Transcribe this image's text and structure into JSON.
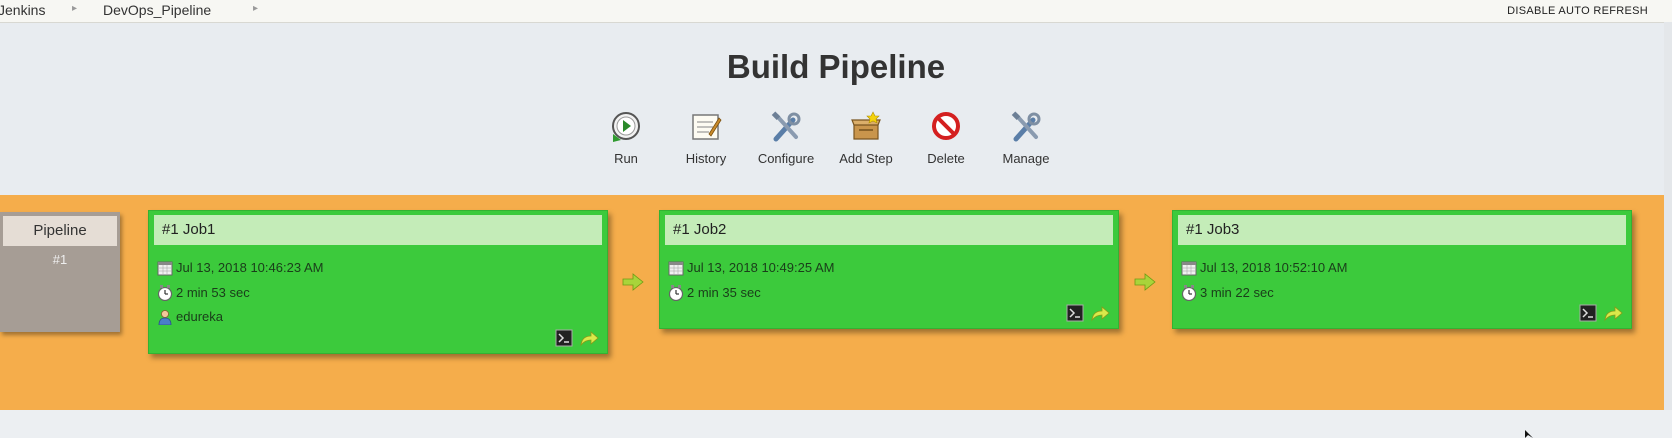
{
  "breadcrumb": {
    "items": [
      "Jenkins",
      "DevOps_Pipeline"
    ]
  },
  "header": {
    "auto_refresh": "DISABLE AUTO REFRESH"
  },
  "title": "Build Pipeline",
  "toolbar": {
    "run": "Run",
    "history": "History",
    "configure": "Configure",
    "add_step": "Add Step",
    "delete": "Delete",
    "manage": "Manage"
  },
  "pipeline": {
    "label": "Pipeline",
    "number": "#1"
  },
  "jobs": [
    {
      "title": "#1 Job1",
      "date": "Jul 13, 2018 10:46:23 AM",
      "duration": "2 min 53 sec",
      "user": "edureka"
    },
    {
      "title": "#1 Job2",
      "date": "Jul 13, 2018 10:49:25 AM",
      "duration": "2 min 35 sec"
    },
    {
      "title": "#1 Job3",
      "date": "Jul 13, 2018 10:52:10 AM",
      "duration": "3 min 22 sec"
    }
  ],
  "icons": {
    "run": "run-icon",
    "history": "history-icon",
    "configure": "configure-icon",
    "add_step": "add-step-icon",
    "delete": "delete-icon",
    "manage": "manage-icon",
    "calendar": "calendar-icon",
    "clock": "clock-icon",
    "user": "user-icon",
    "console": "console-icon",
    "rerun": "rerun-icon",
    "arrow": "next-arrow-icon"
  },
  "colors": {
    "success": "#3cca3c",
    "job_header": "#c4ecb8",
    "pipeline_background": "#f5ad4b",
    "pipeline_box": "#a69d95"
  }
}
